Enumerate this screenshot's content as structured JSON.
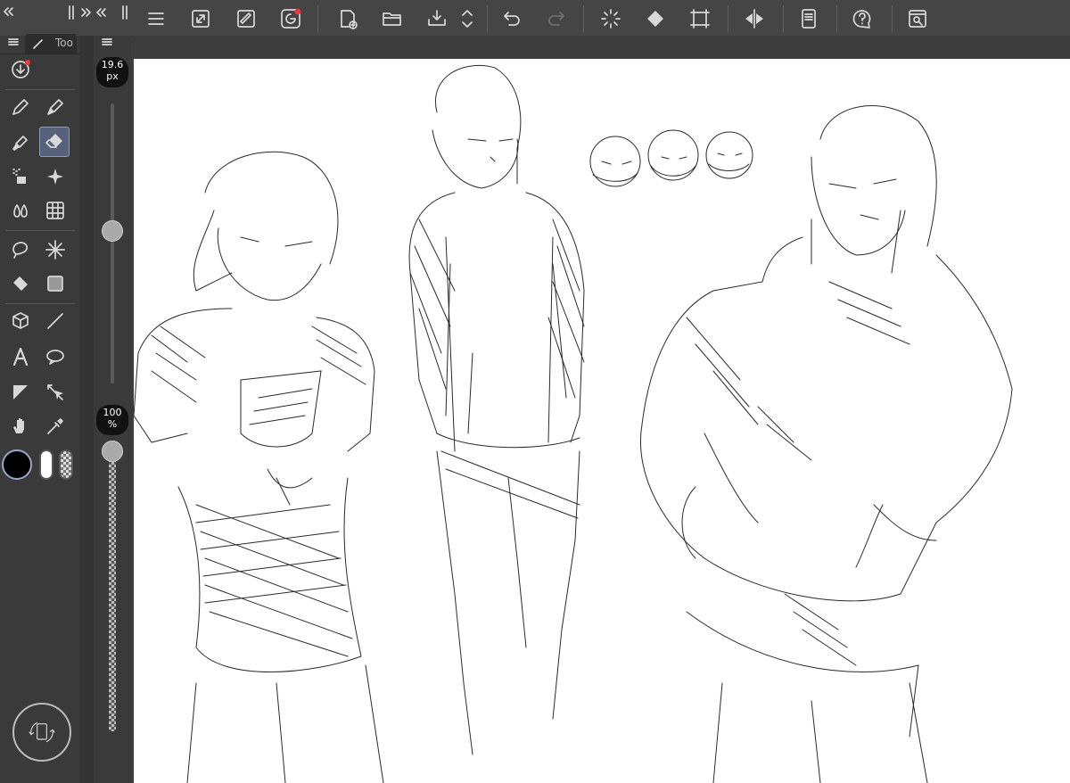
{
  "panel": {
    "tab_label": "Too",
    "collapse_left": "«",
    "collapse_toggle": "»«"
  },
  "brush": {
    "size_value": "19.6",
    "size_unit": "px",
    "size_level": 0.5,
    "opacity_value": "100",
    "opacity_unit": "%",
    "opacity_level": 1.0
  },
  "colors": {
    "main_color": "#000000",
    "sub_color": "#ffffff",
    "accent_dot": "#e63b3b",
    "active_tool_bg": "#56627a"
  },
  "tools": [
    "pen-icon",
    "pencil-icon",
    "brush-icon",
    "eraser-icon",
    "airbrush-icon",
    "decoration-icon",
    "blend-icon",
    "grid-ruler-icon",
    "lasso-icon",
    "auto-select-icon",
    "fill-icon",
    "gradient-icon",
    "object-select-icon",
    "line-icon",
    "text-icon",
    "balloon-icon",
    "frame-border-icon",
    "move-layer-icon",
    "hand-icon",
    "eyedropper-icon"
  ],
  "toolbar": [
    "menu-icon",
    "fullscreen-icon",
    "edit-icon",
    "companion-icon",
    "new-canvas-icon",
    "open-folder-icon",
    "save-icon",
    "updown-icon",
    "undo-icon",
    "redo-icon",
    "loading-icon",
    "fill-icon",
    "transform-icon",
    "flip-icon",
    "smartphone-icon",
    "help-icon",
    "settings-icon"
  ]
}
